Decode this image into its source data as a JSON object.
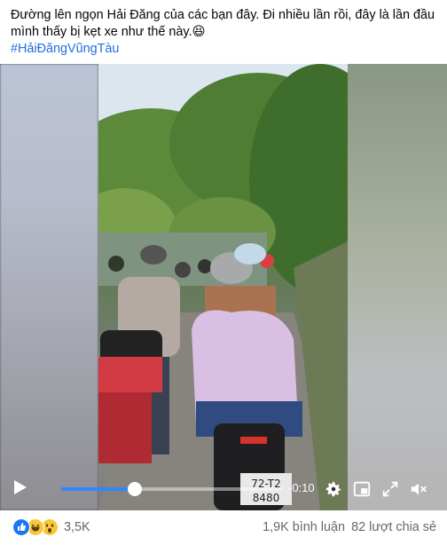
{
  "post": {
    "caption_line1": "Đường lên ngọn Hải Đăng của các bạn đây. Đi nhiều lần rồi, đây là lần đầu",
    "caption_line2": "mình thấy bị kẹt xe như thế này.😆",
    "hashtag": "#HảiĐăngVũngTàu"
  },
  "video": {
    "time_remaining": "-0:10",
    "progress": 0.33,
    "plate_line1": "72-T2",
    "plate_line2": "8480",
    "controls": {
      "play": "play-icon",
      "settings": "gear-icon",
      "pip": "picture-in-picture-icon",
      "fullscreen": "fullscreen-icon",
      "volume": "volume-muted-icon"
    }
  },
  "footer": {
    "reactions": [
      "like-icon",
      "haha-icon",
      "wow-icon"
    ],
    "reaction_count": "3,5K",
    "comments": "1,9K bình luận",
    "shares": "82 lượt chia sẻ"
  },
  "colors": {
    "link": "#216fdb",
    "progress": "#2d88ff",
    "secondary_text": "#65676b"
  }
}
